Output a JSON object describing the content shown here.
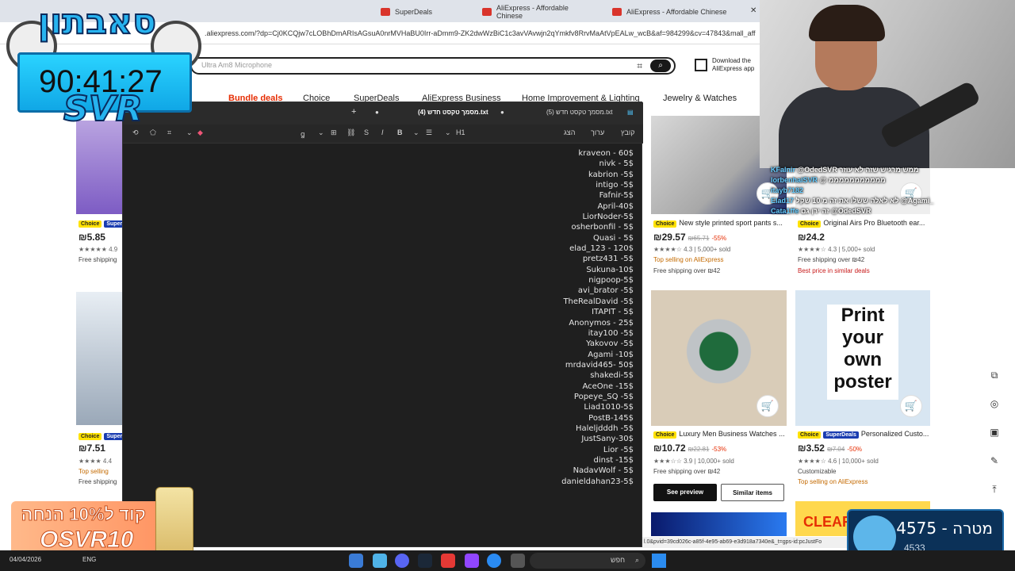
{
  "browser": {
    "tabs": [
      "SuperDeals",
      "AliExpress - Affordable Chinese",
      "AliExpress - Affordable Chinese"
    ],
    "url": ".aliexpress.com/?dp=Cj0KCQjw7cLOBhDmARIsAGsuA0nrMVHaBU0Irr-aDmm9-ZK2dwWzBiC1c3avVAvwjn2qYmkfv8RrvMaAtVpEALw_wcB&af=984299&cv=47843&mall_aff"
  },
  "aliexpress": {
    "search_placeholder": "Ultra Am8 Microphone",
    "app_download": "Download the AliExpress app",
    "nav": [
      "Bundle deals",
      "Choice",
      "SuperDeals",
      "AliExpress Business",
      "Home Improvement & Lighting",
      "Jewelry & Watches"
    ],
    "left_products": [
      {
        "price": "₪5.85",
        "rating": "4.9",
        "note": "Free shipping"
      },
      {
        "price": "₪7.51",
        "rating": "4.4",
        "note": "Top selling",
        "note2": "Free shipping"
      }
    ],
    "products": [
      {
        "title": "New style printed sport pants s...",
        "price": "₪29.57",
        "old": "₪65.71",
        "disc": "-55%",
        "rating": "4.3",
        "sold": "5,000+ sold",
        "note1": "Top selling on AliExpress",
        "note2": "Free shipping over ₪42"
      },
      {
        "title": "Original Airs Pro Bluetooth ear...",
        "price": "₪24.2",
        "rating": "4.3",
        "sold": "5,000+ sold",
        "note1": "Free shipping over ₪42",
        "note2": "Best price in similar deals"
      },
      {
        "title": "Luxury Men Business Watches ...",
        "price": "₪10.72",
        "old": "₪22.81",
        "disc": "-53%",
        "rating": "3.9",
        "sold": "10,000+ sold",
        "note1": "Free shipping over ₪42"
      },
      {
        "title": "Personalized Custo...",
        "price": "₪3.52",
        "old": "₪7.04",
        "disc": "-50%",
        "rating": "4.6",
        "sold": "10,000+ sold",
        "note1": "Customizable",
        "note2": "Top selling on AliExpress"
      }
    ],
    "poster_text": [
      "Print",
      "your",
      "own",
      "poster"
    ],
    "see_preview": "See preview",
    "similar_items": "Similar items",
    "badge_choice": "Choice",
    "badge_superdeals": "SuperDeals",
    "clear_text": "CLEAR",
    "status_url": "l.0&pvid=39cd026c-a85f-4e95-ab69-e3d918a7340e&_t=gps-id:pcJustFo"
  },
  "editor": {
    "tabs": [
      "מסמך טקסט חדש (4).txt",
      "מסמך טקסט חדש (5).txt"
    ],
    "menu": [
      "קובץ",
      "ערוך",
      "הצג"
    ],
    "heading_button": "H1",
    "lines": [
      "kraveon - 60$",
      "nivk - 5$",
      "kabrion -5$",
      "intigo -5$",
      "Fafnir-5$",
      "April-40$",
      "LiorNoder-5$",
      "osherbonfil - 5$",
      "Quasi - 5$",
      "elad_123 - 120$",
      "pretz431 -5$",
      "Sukuna-10$",
      "nigpoop-5$",
      "avi_brator -5$",
      "TheRealDavid -5$",
      "ITAPIT - 5$",
      "Anonymos - 25$",
      "itay100 -5$",
      "Yakovov -5$",
      "Agami -10$",
      "mrdavid465- 50$",
      "shakedi-5$",
      "AceOne -15$",
      "Popeye_SQ -5$",
      "Liad1010-5$",
      "PostB-145$",
      "Haleljdddh -5$",
      "JustSany-30$",
      "Lior -5$",
      "dinst -15$",
      "NadavWolf - 5$",
      "danieldahan23-5$"
    ]
  },
  "stream": {
    "timer": "90:41:27",
    "brand": "SVR",
    "logo_text": "סאבתון",
    "chat": [
      {
        "user": "KFalnir",
        "msg": "@OdedSVR ממש מרגיש שזה לא עוזר"
      },
      {
        "user": "lorbenhaiSVR",
        "msg": "@ מממממממממממ"
      },
      {
        "user": "itayb7182",
        "msg": ""
      },
      {
        "user": "Elad17",
        "msg": "לא לאלה ששלו את זה מ 10 שקל @Agami_"
      },
      {
        "user": "Cata1ffe",
        "msg": "זה ירן גם @OdedSVR"
      }
    ],
    "promo_line1": "קוד ל10% הנחה",
    "promo_line2": "OSVR10",
    "goal_label": "4575 - מטרה",
    "goal_sub": "4533"
  },
  "taskbar": {
    "date": "04/04/2026",
    "lang": "ENG",
    "search": "חפש"
  }
}
